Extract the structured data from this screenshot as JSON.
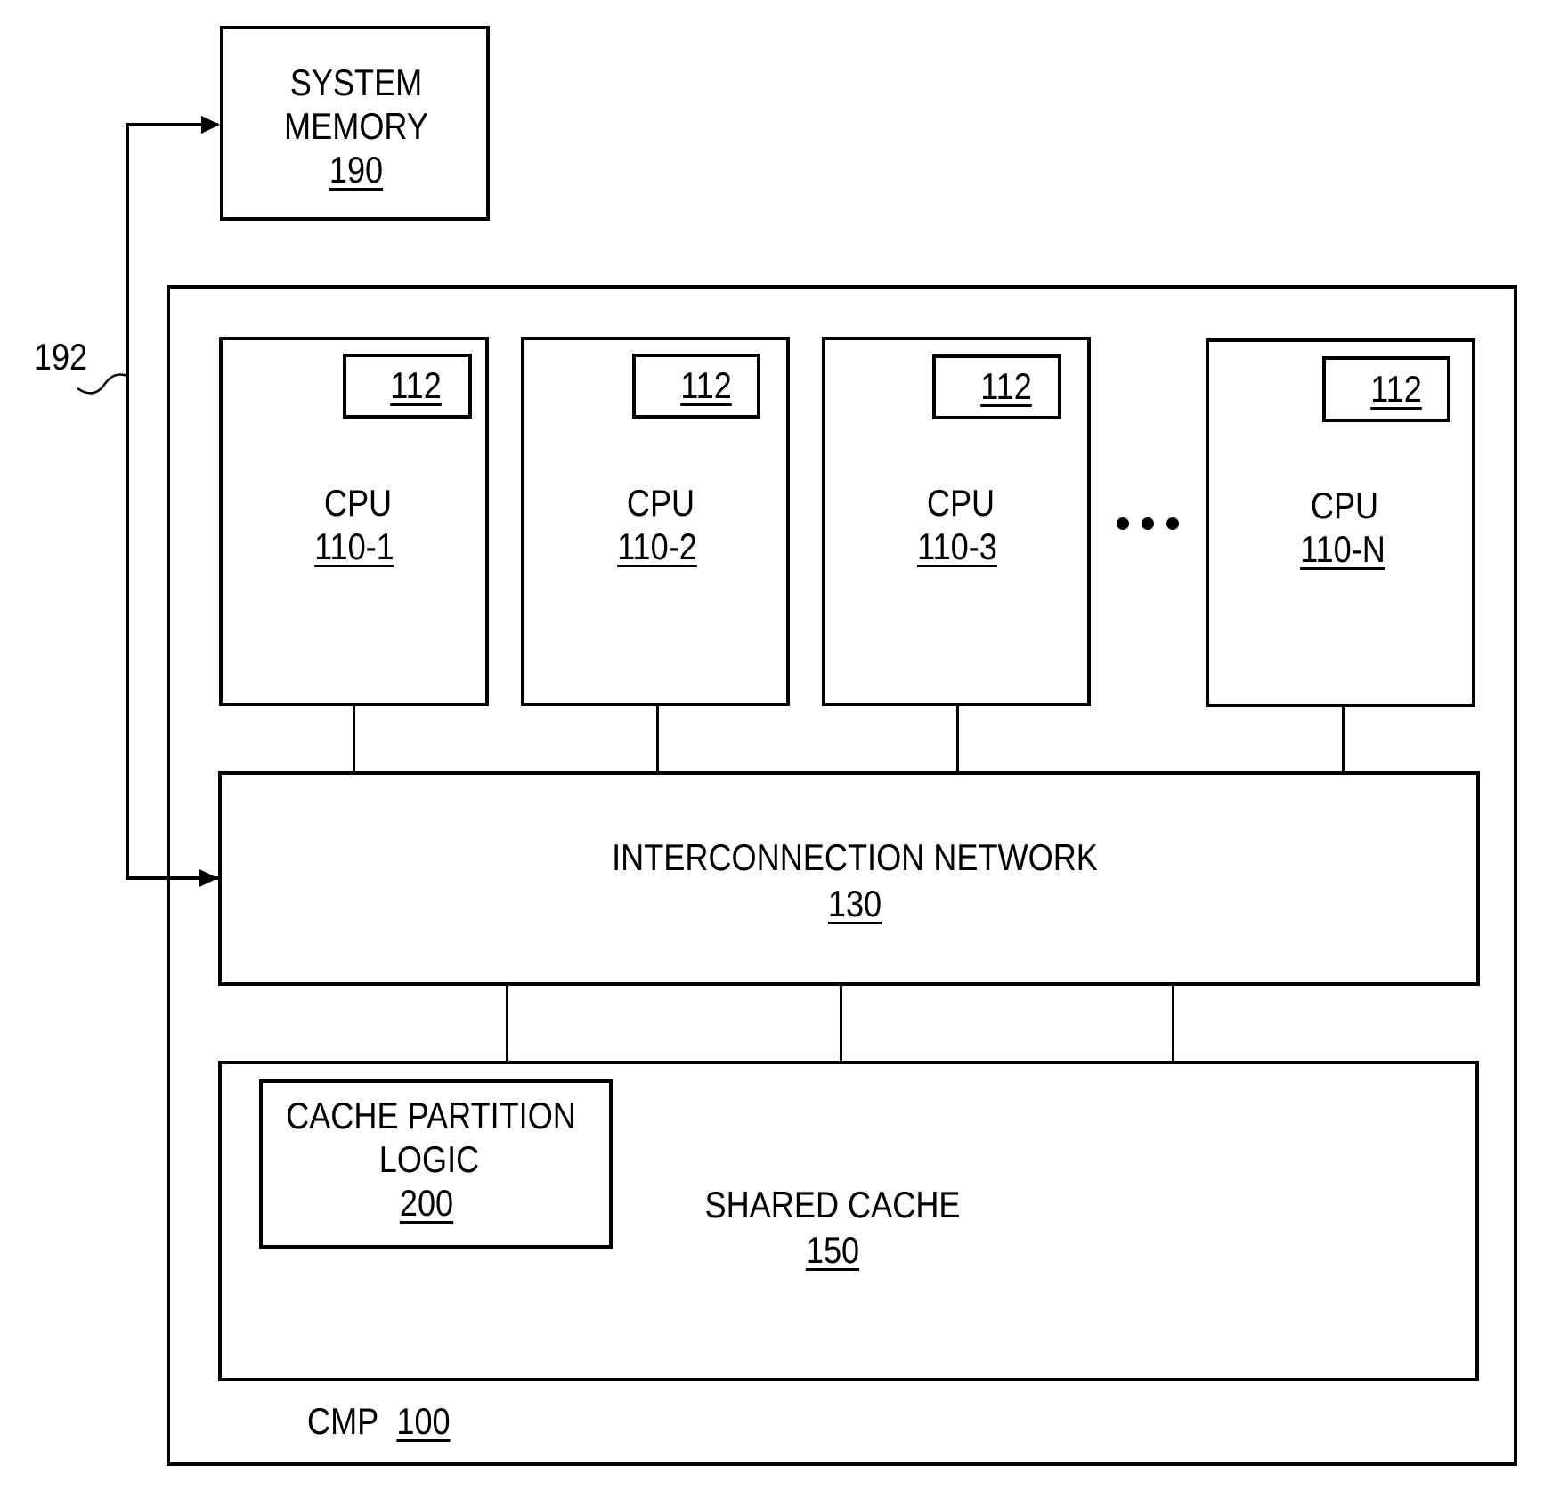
{
  "system_memory": {
    "title_line1": "SYSTEM",
    "title_line2": "MEMORY",
    "ref": "190"
  },
  "bus": {
    "ref": "192"
  },
  "cmp": {
    "title": "CMP",
    "ref": "100"
  },
  "cpus": [
    {
      "title": "CPU",
      "ref": "110-1",
      "cache_ref": "112"
    },
    {
      "title": "CPU",
      "ref": "110-2",
      "cache_ref": "112"
    },
    {
      "title": "CPU",
      "ref": "110-3",
      "cache_ref": "112"
    },
    {
      "title": "CPU",
      "ref": "110-N",
      "cache_ref": "112"
    }
  ],
  "ellipsis": "...",
  "interconnect": {
    "title": "INTERCONNECTION NETWORK",
    "ref": "130"
  },
  "shared_cache": {
    "title": "SHARED CACHE",
    "ref": "150"
  },
  "cache_partition_logic": {
    "title_line1": "CACHE PARTITION",
    "title_line2": "LOGIC",
    "ref": "200"
  }
}
